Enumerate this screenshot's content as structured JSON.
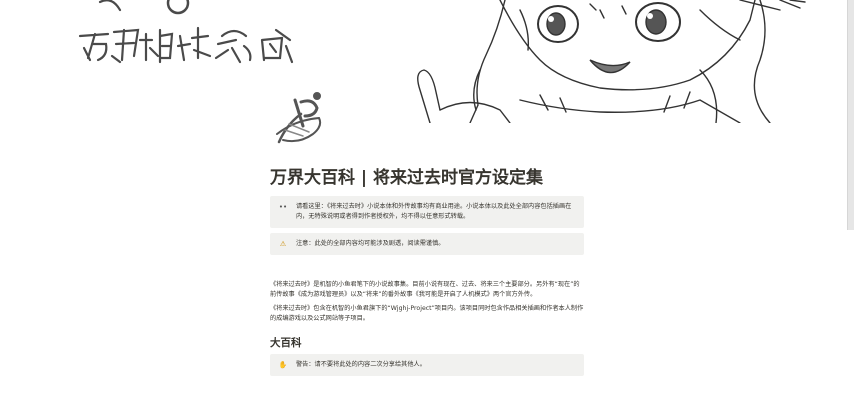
{
  "header": {
    "logo_text": "万界相杜后"
  },
  "page": {
    "title": "万界大百科 | 将来过去时官方设定集",
    "icon": "logo-icon"
  },
  "callouts": [
    {
      "icon": "dots-icon",
      "icon_glyph": "••",
      "text": "请看这里：《将来过去时》小说本体和外传故事均有商业用途。小说本体以及此处全部内容包括插画在内，无特殊说明或者得到作者授权外，均不得以任意形式转载。"
    },
    {
      "icon": "warning-icon",
      "icon_glyph": "⚠",
      "text": "注意：此处的全部内容均可能涉及剧透，阅读需谨慎。"
    }
  ],
  "paragraphs": [
    "《将来过去时》是机智的小鱼君笔下的小说故事集。目前小说有现在、过去、将来三个主要部分。另外有“现在”的前传故事《成为游戏管理员》以及“将来”的番外故事《我可能是开启了人机模式》两个官方外传。",
    "《将来过去时》包含在机智的小鱼君旗下的“Wjghj-Project”项目内。该项目同时包含作品相关插画和作者本人制作的成编游戏以及公式网站等子项目。"
  ],
  "section": {
    "heading": "大百科",
    "callout": {
      "icon": "hand-icon",
      "icon_glyph": "✋",
      "text": "警告：请不要将此处的内容二次分享给其他人。"
    }
  },
  "colors": {
    "callout_bg": "#f1f1ef",
    "text": "#37352f",
    "warning": "#e3a008"
  }
}
